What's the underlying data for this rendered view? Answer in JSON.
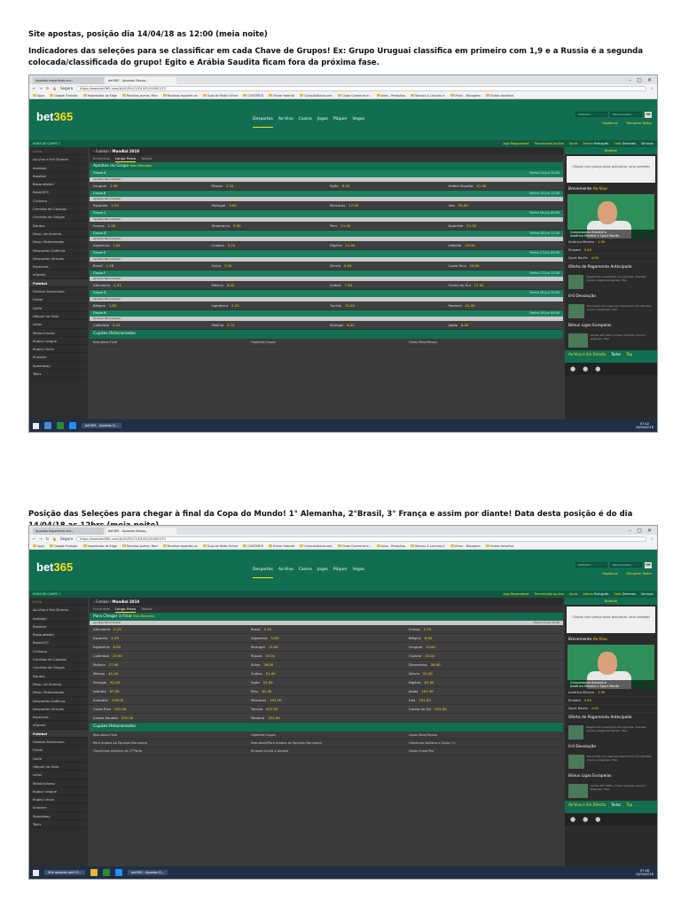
{
  "doc": {
    "title1": "Site apostas, posição dia 14/04/18 as 12:00 (meia noite)",
    "paragraph1": "Indicadores das seleções para se classificar em cada Chave de Grupos! Ex: Grupo Uruguai classifica em primeiro com 1,9 e a Russia é a segunda colocada/classificada do grupo! Egito e Arábia Saudita ficam fora da próxima fase.",
    "title2": "Posição das Seleções para chegar à final da Copa do Mundo! 1° Alemanha, 2°Brasil, 3° França e assim por diante! Data desta posição é do dia 14/04/18 as 12hrs (meia noite)"
  },
  "browser": {
    "tab1": "Apostas esportivas em...",
    "tab2": "bet365 - Apostas Despo...",
    "secure": "Seguro",
    "url1": "https://www.bet365.com/#/AC/B1/C1/D1002/G40/E1/F2",
    "url2": "https://www.bet365.com/#/AC/B1/C1/D1002/G40/E2/F2",
    "bookmarks": [
      "Apps",
      "Google Tradutor",
      "Importados da Edge",
      "Revistas Jovens, Revi",
      "Revistas esportes on",
      "Guia de Mídia Online",
      "CONTENTS",
      "Entrar Hotmail",
      "ConsultaSocio.com",
      "Clube Comercial e...",
      "Aves - Periquitos",
      "Bancos & Lanchas e",
      "Vinho - Tatuagens",
      "Outros favoritos"
    ]
  },
  "site": {
    "logo_main": "bet",
    "logo_num": "365",
    "nav": [
      "Desportos",
      "Ao-Vivo",
      "Casino",
      "Jogos",
      "Póquer",
      "Vegas"
    ],
    "user_placeholder": "Utilizador",
    "pass_placeholder": "Palavra-passe",
    "ok": "OK",
    "register": "Registe-se",
    "recover": "Recuperar Dados",
    "sub_left": "HORA DE CAMPO 1",
    "sub_right": [
      "Jogo Responsável",
      "Transmissão Ao-Vivo",
      "Ajuda"
    ],
    "idioma_label": "Idioma",
    "idioma": "Português",
    "odds_label": "Odds",
    "odds": "Decimais",
    "servicos": "Serviços"
  },
  "sidebar1": [
    "Início",
    "Ao-Vivo e Em Directo",
    "Andebol",
    "Basebol",
    "Basquetebol",
    "Boxe/UFC",
    "Ciclismo",
    "Corridas de Cavalos",
    "Corridas de Galgos",
    "Dardos",
    "Desp. de Inverno",
    "Desp. Motorizados",
    "Desportos Gaélicos",
    "Desportos Virtuais",
    "Especiais",
    "eSports",
    "Futebol",
    "Futebol Americano",
    "Futsal",
    "Golfe",
    "Hóquei no Gelo",
    "Lotos",
    "Motociclismo",
    "Rugby League",
    "Rugby Union",
    "Snooker",
    "Speedway",
    "Ténis"
  ],
  "sidebar2": [
    "Início",
    "Ao-Vivo e Em Directo",
    "Andebol",
    "Basebol",
    "Basquetebol",
    "Boxe/UFC",
    "Ciclismo",
    "Corridas de Cavalos",
    "Corridas de Galgos",
    "Dardos",
    "Desp. de Inverno",
    "Desp. Motorizados",
    "Desportos Gaélicos",
    "Desportos Virtuais",
    "Especiais",
    "eSports",
    "Futebol",
    "Futebol Americano",
    "Futsal",
    "Golfe",
    "Hóquei no Gelo",
    "Lotos",
    "Motociclismo",
    "Rugby League",
    "Rugby Union",
    "Snooker",
    "Speedway",
    "Ténis"
  ],
  "crumb": {
    "futebol": "Futebol",
    "mundial": "Mundial 2018"
  },
  "subtabs": [
    "Encontros",
    "Longo Prazo",
    "Tabela"
  ],
  "market1": {
    "title": "Apostas no Grupo",
    "more": "Mais Mercados",
    "sel_label": "Apostas Para Ganhar",
    "groups": [
      {
        "name": "Grupo A",
        "when": "Fecha 14 Jun 12:00",
        "teams": [
          [
            "Uruguai",
            "1.90"
          ],
          [
            "Rússia",
            "2.20"
          ],
          [
            "Egito",
            "6.00"
          ],
          [
            "Arábia Saudita",
            "41.00"
          ]
        ]
      },
      {
        "name": "Grupo B",
        "when": "Fecha 15 Jun 12:00",
        "teams": [
          [
            "Espanha",
            "1.53"
          ],
          [
            "Portugal",
            "3.00"
          ],
          [
            "Marrocos",
            "17.00"
          ],
          [
            "Irão",
            "34.00"
          ]
        ]
      },
      {
        "name": "Grupo C",
        "when": "Fecha 16 Jun 09:00",
        "teams": [
          [
            "França",
            "1.28"
          ],
          [
            "Dinamarca",
            "5.50"
          ],
          [
            "Peru",
            "11.00"
          ],
          [
            "Austrália",
            "21.00"
          ]
        ]
      },
      {
        "name": "Grupo D",
        "when": "Fecha 16 Jun 12:00",
        "teams": [
          [
            "Argentina",
            "1.61"
          ],
          [
            "Croácia",
            "3.25"
          ],
          [
            "Nigéria",
            "11.00"
          ],
          [
            "Islândia",
            "13.00"
          ]
        ]
      },
      {
        "name": "Grupo E",
        "when": "Fecha 17 Jun 09:00",
        "teams": [
          [
            "Brasil",
            "1.28"
          ],
          [
            "Suíça",
            "7.00"
          ],
          [
            "Sérvia",
            "9.00"
          ],
          [
            "Costa Rica",
            "19.00"
          ]
        ]
      },
      {
        "name": "Grupo F",
        "when": "Fecha 17 Jun 12:00",
        "teams": [
          [
            "Alemanha",
            "1.33"
          ],
          [
            "México",
            "6.00"
          ],
          [
            "Suécia",
            "7.50"
          ],
          [
            "Coreia do Sul",
            "17.00"
          ]
        ]
      },
      {
        "name": "Grupo G",
        "when": "Fecha 18 Jun 12:00",
        "teams": [
          [
            "Bélgica",
            "1.83"
          ],
          [
            "Inglaterra",
            "2.20"
          ],
          [
            "Tunísia",
            "15.00"
          ],
          [
            "Panamá",
            "41.00"
          ]
        ]
      },
      {
        "name": "Grupo H",
        "when": "Fecha 19 Jun 09:00",
        "teams": [
          [
            "Colômbia",
            "2.25"
          ],
          [
            "Polónia",
            "2.75"
          ],
          [
            "Senegal",
            "6.00"
          ],
          [
            "Japão",
            "8.00"
          ]
        ]
      }
    ],
    "related": "Cupões Relacionados",
    "rel_row": [
      "Resultado Final",
      "Hipótese Dupla",
      "Golos Mais/Menos"
    ]
  },
  "market2": {
    "title": "Para Chegar à Final",
    "more": "Mais Mercados",
    "sel_label": "Apostas Para Ganhar",
    "when": "Fecha 14 Jun 12:00",
    "rows": [
      [
        [
          "Alemanha",
          "2.25"
        ],
        [
          "Brasil",
          "2.25"
        ],
        [
          "França",
          "2.75"
        ]
      ],
      [
        [
          "Espanha",
          "4.33"
        ],
        [
          "Argentina",
          "5.00"
        ],
        [
          "Bélgica",
          "6.00"
        ]
      ],
      [
        [
          "Inglaterra",
          "9.00"
        ],
        [
          "Portugal",
          "13.00"
        ],
        [
          "Uruguai",
          "13.00"
        ]
      ],
      [
        [
          "Colômbia",
          "13.00"
        ],
        [
          "Rússia",
          "15.00"
        ],
        [
          "Croácia",
          "15.00"
        ]
      ],
      [
        [
          "Polónia",
          "17.00"
        ],
        [
          "Suíça",
          "26.00"
        ],
        [
          "Dinamarca",
          "26.00"
        ]
      ],
      [
        [
          "México",
          "41.00"
        ],
        [
          "Suécia",
          "51.00"
        ],
        [
          "Sérvia",
          "51.00"
        ]
      ],
      [
        [
          "Senegal",
          "51.00"
        ],
        [
          "Egito",
          "51.00"
        ],
        [
          "Nigéria",
          "67.00"
        ]
      ],
      [
        [
          "Islândia",
          "67.00"
        ],
        [
          "Peru",
          "81.00"
        ],
        [
          "Japão",
          "101.00"
        ]
      ],
      [
        [
          "Austrália",
          "126.00"
        ],
        [
          "Marrocos",
          "151.00"
        ],
        [
          "Irão",
          "151.00"
        ]
      ],
      [
        [
          "Costa Rica",
          "151.00"
        ],
        [
          "Tunísia",
          "201.00"
        ],
        [
          "Coreia do Sul",
          "201.00"
        ]
      ],
      [
        [
          "Arábia Saudita",
          "251.00"
        ],
        [
          "Panamá",
          "251.00"
        ],
        [
          "",
          ""
        ]
      ]
    ],
    "related": "Cupões Relacionados",
    "rel_rows": [
      [
        "Resultado Final",
        "Hipótese Dupla",
        "Golos Mais/Menos"
      ],
      [
        "Para Ambas as Equipas Marcarem",
        "Resultado/Para Ambas as Equipas Marcarem",
        "Handicap Asiático e Golos +/-"
      ],
      [
        "Handicaps Asiático da 1ª Parte",
        "Empate Anula a Aposta",
        "Golos Ímpar/Par"
      ]
    ]
  },
  "rpanel": {
    "slip_title": "Boletim",
    "slip_text": "Clique num preço para adicionar uma seleção",
    "live_label": "Brevemente",
    "live_y": "Ao-Vivo",
    "caption1": "Campeonato Brasileiro",
    "caption2": "América Mineiro v Sport Recife",
    "lines": [
      [
        "América Mineiro",
        "1.90"
      ],
      [
        "Empate",
        "3.40"
      ],
      [
        "Sport Recife",
        "4.00"
      ]
    ],
    "promo1_title": "Oferta de Pagamento Antecipado",
    "promo1_text": "Pagamento antecipado em apostas. Clientes novos e elegíveis apenas. T&C.",
    "promo2_title": "0-0 Devolução",
    "promo2_text": "Devolução em jogos que terminem 0-0. Clientes novos e elegíveis. T&C.",
    "promo3_title": "Bónus Ligas Europeias",
    "promo3_text": "Ganhe até 100% a mais. Clientes novos e elegíveis. T&C.",
    "inplay": "Ao-Vivo e Em Directo",
    "inplay_all": "Todos",
    "inplay_tab": "Top"
  },
  "taskbar": {
    "app1": "bet365 - Apostas D...",
    "app0": "Site apostas abril15...",
    "lang": "POR PTB2",
    "time1": "07:42",
    "date": "15/04/2018",
    "time2": "07:48"
  }
}
